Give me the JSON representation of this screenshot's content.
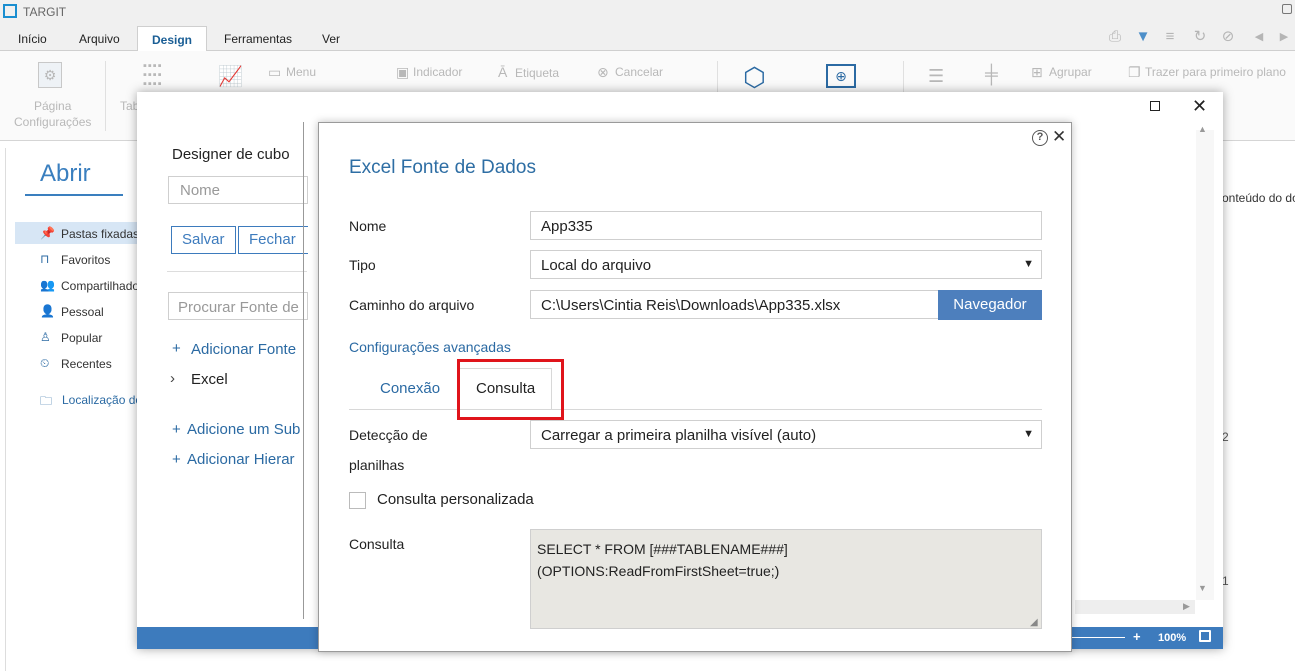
{
  "app": {
    "title": "TARGIT"
  },
  "menu_tabs": [
    "Início",
    "Arquivo",
    "Design",
    "Ferramentas",
    "Ver"
  ],
  "ribbon": {
    "page_config": [
      "Página",
      "Configurações"
    ],
    "tab_partial": "Tab",
    "menu": "Menu",
    "indicador": "Indicador",
    "etiqueta": "Etiqueta",
    "cancelar": "Cancelar",
    "agrupar": "Agrupar",
    "trazer": "Trazer para primeiro plano"
  },
  "background": {
    "abrir": "Abrir",
    "nav": [
      "Pastas fixadas",
      "Favoritos",
      "Compartilhado",
      "Pessoal",
      "Popular",
      "Recentes"
    ],
    "localizacao": "Localização do",
    "right_text": "onteúdo do do",
    "num_a": "2",
    "num_b": "1"
  },
  "outer_dialog": {
    "title": "Designer de cubo",
    "name_placeholder": "Nome",
    "save": "Salvar",
    "close": "Fechar",
    "search_placeholder": "Procurar Fonte de",
    "add_source": "Adicionar Fonte",
    "tree_item": "Excel",
    "add_sub": "Adicione um Sub",
    "add_hier": "Adicionar Hierar",
    "zoom": "100%"
  },
  "inner_dialog": {
    "title": "Excel Fonte de Dados",
    "fields": {
      "nome_label": "Nome",
      "nome_value": "App335",
      "tipo_label": "Tipo",
      "tipo_value": "Local do arquivo",
      "caminho_label": "Caminho do arquivo",
      "caminho_value": "C:\\Users\\Cintia Reis\\Downloads\\App335.xlsx",
      "browse": "Navegador"
    },
    "advanced_link": "Configurações avançadas",
    "tabs": [
      "Conexão",
      "Consulta"
    ],
    "deteccao_label_1": "Detecção de",
    "deteccao_label_2": "planilhas",
    "deteccao_value": "Carregar a primeira planilha visível (auto)",
    "custom_query_label": "Consulta personalizada",
    "query_label": "Consulta",
    "query_line_1": "SELECT * FROM [###TABLENAME###]",
    "query_line_2": "(OPTIONS:ReadFromFirstSheet=true;)"
  },
  "colors": {
    "accent": "#3d7bbd",
    "title_blue": "#2e6ea4",
    "highlight": "#e0141b"
  }
}
